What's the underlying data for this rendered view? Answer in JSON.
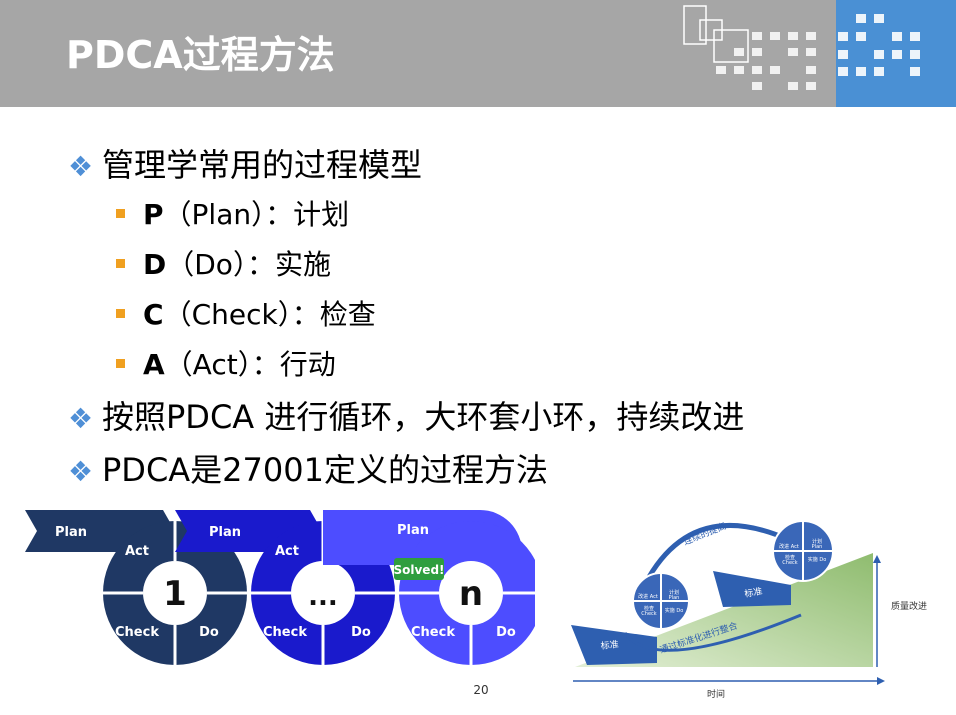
{
  "slide": {
    "title": "PDCA过程方法",
    "page_number": "20"
  },
  "bullets": [
    {
      "text": "管理学常用的过程模型"
    },
    {
      "text": "按照PDCA 进行循环，大环套小环，持续改进"
    },
    {
      "text": "PDCA是27001定义的过程方法"
    }
  ],
  "sub_bullets": [
    {
      "key": "P",
      "text": "（Plan）：计划"
    },
    {
      "key": "D",
      "text": "（Do）：实施"
    },
    {
      "key": "C",
      "text": "（Check）：检查"
    },
    {
      "key": "A",
      "text": "（Act）：行动"
    }
  ],
  "cycle_diagram": {
    "plan_label": "Plan",
    "act_label": "Act",
    "check_label": "Check",
    "do_label": "Do",
    "cycles": [
      "1",
      "...",
      "n"
    ],
    "solved_badge": "Solved!",
    "colors": {
      "dark": "#1f3864",
      "mid": "#1a1acc",
      "light": "#4d4dff",
      "solved": "#2e9e3e"
    }
  },
  "improvement_diagram": {
    "rise_label": "连续的提高",
    "standard_label": "标准",
    "consolidation_label": "通过标准化进行整合",
    "y_axis_label": "质量改进",
    "x_axis_label": "时间",
    "wheel_act": "改进 Act",
    "wheel_plan_cn": "计划",
    "wheel_plan_en": "Plan",
    "wheel_check_cn": "检查",
    "wheel_check_en": "Check",
    "wheel_do": "实施 Do"
  }
}
